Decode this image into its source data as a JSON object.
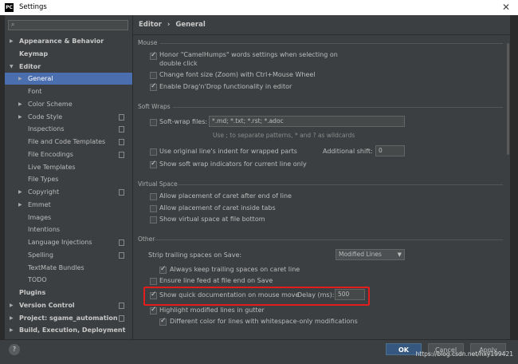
{
  "window": {
    "title": "Settings",
    "app_icon_text": "PC"
  },
  "search": {
    "placeholder": ""
  },
  "sidebar": {
    "items": [
      {
        "label": "Appearance & Behavior",
        "level": 0,
        "bold": true,
        "arrow": "▶"
      },
      {
        "label": "Keymap",
        "level": 0,
        "bold": true,
        "arrow": ""
      },
      {
        "label": "Editor",
        "level": 0,
        "bold": true,
        "arrow": "▼"
      },
      {
        "label": "General",
        "level": 1,
        "bold": false,
        "arrow": "▶",
        "selected": true
      },
      {
        "label": "Font",
        "level": 1,
        "bold": false,
        "arrow": ""
      },
      {
        "label": "Color Scheme",
        "level": 1,
        "bold": false,
        "arrow": "▶"
      },
      {
        "label": "Code Style",
        "level": 1,
        "bold": false,
        "arrow": "▶",
        "copy": true
      },
      {
        "label": "Inspections",
        "level": 1,
        "bold": false,
        "arrow": "",
        "copy": true
      },
      {
        "label": "File and Code Templates",
        "level": 1,
        "bold": false,
        "arrow": "",
        "copy": true
      },
      {
        "label": "File Encodings",
        "level": 1,
        "bold": false,
        "arrow": "",
        "copy": true
      },
      {
        "label": "Live Templates",
        "level": 1,
        "bold": false,
        "arrow": ""
      },
      {
        "label": "File Types",
        "level": 1,
        "bold": false,
        "arrow": ""
      },
      {
        "label": "Copyright",
        "level": 1,
        "bold": false,
        "arrow": "▶",
        "copy": true
      },
      {
        "label": "Emmet",
        "level": 1,
        "bold": false,
        "arrow": "▶"
      },
      {
        "label": "Images",
        "level": 1,
        "bold": false,
        "arrow": ""
      },
      {
        "label": "Intentions",
        "level": 1,
        "bold": false,
        "arrow": ""
      },
      {
        "label": "Language Injections",
        "level": 1,
        "bold": false,
        "arrow": "",
        "copy": true
      },
      {
        "label": "Spelling",
        "level": 1,
        "bold": false,
        "arrow": "",
        "copy": true
      },
      {
        "label": "TextMate Bundles",
        "level": 1,
        "bold": false,
        "arrow": ""
      },
      {
        "label": "TODO",
        "level": 1,
        "bold": false,
        "arrow": ""
      },
      {
        "label": "Plugins",
        "level": 0,
        "bold": true,
        "arrow": ""
      },
      {
        "label": "Version Control",
        "level": 0,
        "bold": true,
        "arrow": "▶",
        "copy": true
      },
      {
        "label": "Project: sgame_automation",
        "level": 0,
        "bold": true,
        "arrow": "▶",
        "copy": true
      },
      {
        "label": "Build, Execution, Deployment",
        "level": 0,
        "bold": true,
        "arrow": "▶"
      }
    ]
  },
  "breadcrumb": {
    "parent": "Editor",
    "separator": "›",
    "current": "General"
  },
  "sections": {
    "mouse": "Mouse",
    "soft_wraps": "Soft Wraps",
    "virtual_space": "Virtual Space",
    "other": "Other"
  },
  "mouse": {
    "camelhumps_line1": "Honor \"CamelHumps\" words settings when selecting on",
    "camelhumps_line2": "double click",
    "change_font": "Change font size (Zoom) with Ctrl+Mouse Wheel",
    "drag_drop": "Enable Drag'n'Drop functionality in editor"
  },
  "soft_wraps": {
    "label": "Soft-wrap files:",
    "value": "*.md; *.txt; *.rst; *.adoc",
    "hint": "Use ; to separate patterns, * and ? as wildcards",
    "original_indent": "Use original line's indent for wrapped parts",
    "additional_shift_label": "Additional shift:",
    "additional_shift_value": "0",
    "show_indicators": "Show soft wrap indicators for current line only"
  },
  "virtual_space": {
    "after_end": "Allow placement of caret after end of line",
    "inside_tabs": "Allow placement of caret inside tabs",
    "show_virtual": "Show virtual space at file bottom"
  },
  "other": {
    "strip_label": "Strip trailing spaces on Save:",
    "strip_value": "Modified Lines",
    "keep_trailing": "Always keep trailing spaces on caret line",
    "line_feed": "Ensure line feed at file end on Save",
    "quick_doc": "Show quick documentation on mouse move",
    "delay_label": "Delay (ms):",
    "delay_value": "500",
    "highlight_modified": "Highlight modified lines in gutter",
    "different_color": "Different color for lines with whitespace-only modifications"
  },
  "buttons": {
    "help": "?",
    "ok": "OK",
    "cancel": "Cancel",
    "apply": "Apply"
  },
  "watermark": "https://blog.csdn.net/hxy199421"
}
